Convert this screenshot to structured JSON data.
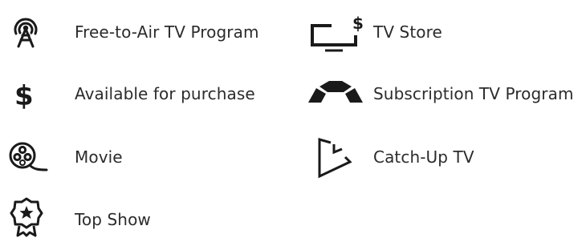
{
  "legend": {
    "items": [
      {
        "icon": "antenna-tower-icon",
        "label": "Free-to-Air TV Program"
      },
      {
        "icon": "tv-store-icon",
        "label": "TV Store"
      },
      {
        "icon": "dollar-sign-icon",
        "label": "Available for purchase"
      },
      {
        "icon": "subscription-arc-icon",
        "label": "Subscription TV Program"
      },
      {
        "icon": "film-reel-icon",
        "label": "Movie"
      },
      {
        "icon": "catch-up-play-icon",
        "label": "Catch-Up TV"
      },
      {
        "icon": "award-badge-icon",
        "label": "Top Show"
      }
    ]
  },
  "colors": {
    "icon": "#1a1a1a",
    "text": "#2b2b2b",
    "background": "#ffffff"
  }
}
